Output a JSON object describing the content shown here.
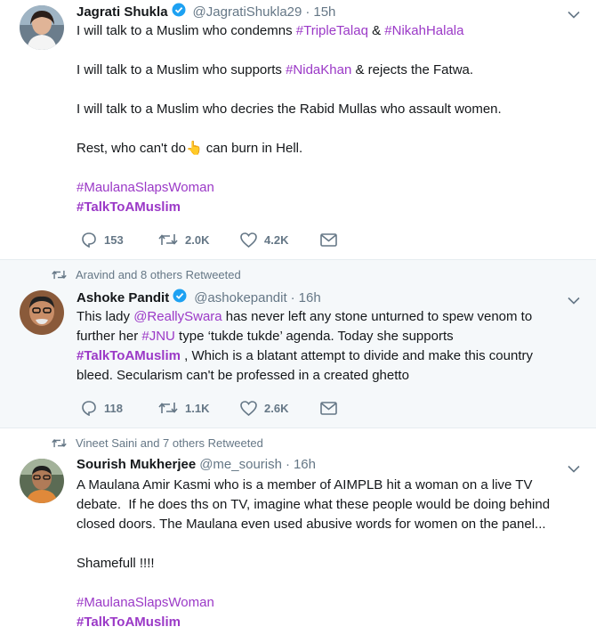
{
  "tweets": [
    {
      "name": "Jagrati Shukla",
      "handle": "@JagratiShukla29",
      "time": "15h",
      "lines": [
        [
          "I will talk to a Muslim who condemns ",
          "#TripleTalaq",
          " & ",
          "#NikahHalala"
        ],
        [
          "I will talk to a Muslim who supports ",
          "#NidaKhan",
          " & rejects the Fatwa."
        ],
        [
          "I will talk to a Muslim who decries the Rabid Mullas who assault women."
        ],
        [
          "Rest, who can't do",
          " can burn in Hell."
        ],
        [
          "#MaulanaSlapsWoman"
        ],
        [
          "#TalkToAMuslim"
        ]
      ],
      "emoji": "👆",
      "replies": "153",
      "retweets": "2.0K",
      "likes": "4.2K"
    },
    {
      "retweeted_by": "Aravind and 8 others Retweeted",
      "name": "Ashoke Pandit",
      "handle": "@ashokepandit",
      "time": "16h",
      "lines": [
        [
          "This lady ",
          "@ReallySwara",
          " has never left any stone unturned to spew venom to"
        ],
        [
          "further her ",
          "#JNU",
          " type ‘tukde tukde’ agenda. Today she supports"
        ],
        [
          "#TalkToAMuslim",
          " , Which is a blatant attempt to divide and make this country"
        ],
        [
          "bleed. Secularism can't be professed in a created ghetto"
        ]
      ],
      "replies": "118",
      "retweets": "1.1K",
      "likes": "2.6K"
    },
    {
      "retweeted_by": "Vineet Saini and 7 others Retweeted",
      "name": "Sourish Mukherjee",
      "handle": "@me_sourish",
      "time": "16h",
      "lines": [
        [
          "A Maulana Amir Kasmi who is a member of AIMPLB hit a woman on a live TV"
        ],
        [
          "debate.  If he does ths on TV, imagine what these people would be doing behind"
        ],
        [
          "closed doors. The Maulana even used abusive words for women on the panel..."
        ],
        [
          "Shamefull !!!!"
        ],
        [
          "#MaulanaSlapsWoman"
        ],
        [
          "#TalkToAMuslim"
        ]
      ]
    }
  ],
  "colors": {
    "hashtag": "#9b39c7",
    "verified": "#1da1f2",
    "secondary_text": "#657786"
  }
}
